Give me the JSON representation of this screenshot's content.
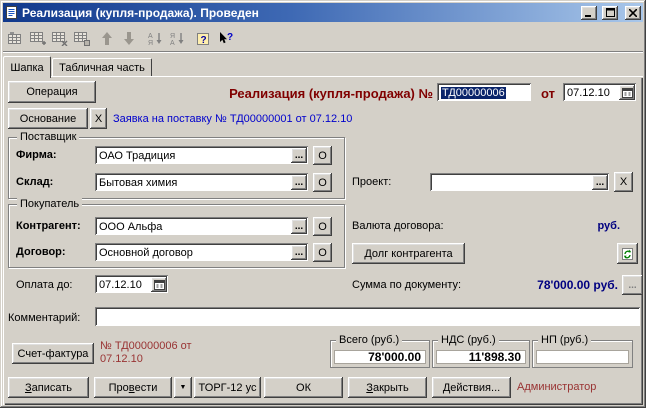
{
  "window": {
    "title": "Реализация (купля-продажа). Проведен"
  },
  "toolbar": {
    "icons": [
      "edit-row",
      "add-row",
      "delete-row",
      "copy-row",
      "move-up",
      "move-down",
      "sort-asc",
      "sort-desc",
      "help",
      "context-help"
    ]
  },
  "tabs": {
    "header": "Шапка",
    "table_part": "Табличная часть"
  },
  "header": {
    "operation": "Операция",
    "doc_title": "Реализация (купля-продажа) №",
    "doc_number": "ТД00000006",
    "from_label": "от",
    "doc_date": "07.12.10"
  },
  "basis": {
    "button": "Основание",
    "clear": "X",
    "text": "Заявка на поставку № ТД00000001 от 07.12.10"
  },
  "supplier": {
    "title": "Поставщик",
    "firm_label": "Фирма:",
    "firm_value": "ОАО Традиция",
    "warehouse_label": "Склад:",
    "warehouse_value": "Бытовая химия"
  },
  "project": {
    "label": "Проект:",
    "value": "",
    "clear": "X"
  },
  "buyer": {
    "title": "Покупатель",
    "contractor_label": "Контрагент:",
    "contractor_value": "ООО Альфа",
    "contract_label": "Договор:",
    "contract_value": "Основной договор"
  },
  "currency": {
    "label": "Валюта договора:",
    "value": "руб."
  },
  "debt_button": "Долг контрагента",
  "payment": {
    "label": "Оплата до:",
    "date": "07.12.10"
  },
  "sum": {
    "label": "Сумма по документу:",
    "value": "78'000.00 руб."
  },
  "comment": {
    "label": "Комментарий:",
    "value": ""
  },
  "invoice": {
    "button": "Счет-фактура",
    "line1": "№ ТД00000006 от",
    "line2": "07.12.10"
  },
  "totals": [
    {
      "label": "Всего (руб.)",
      "value": "78'000.00"
    },
    {
      "label": "НДС (руб.)",
      "value": "11'898.30"
    },
    {
      "label": "НП (руб.)",
      "value": ""
    }
  ],
  "lookup": {
    "ellipsis": "...",
    "open": "О"
  },
  "footer": {
    "save_pre": "",
    "save_u": "З",
    "save_rest": "аписать",
    "post_pre": "Про",
    "post_u": "в",
    "post_rest": "ести",
    "menu": "▼",
    "torg": "ТОРГ-12 ус",
    "ok": "ОК",
    "close_pre": "",
    "close_u": "З",
    "close_rest": "акрыть",
    "actions_pre": "",
    "actions_u": "Д",
    "actions_rest": "ействия...",
    "user": "Администратор"
  },
  "colors": {
    "accent_red": "#800000",
    "link_blue": "#0000cc",
    "value_navy": "#000080",
    "titlebar_blue": "#11398c"
  }
}
